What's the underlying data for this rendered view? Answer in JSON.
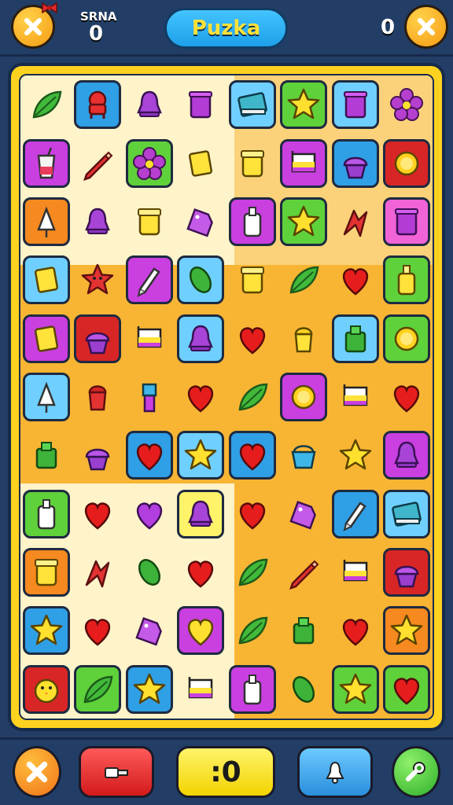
{
  "header": {
    "left_button_icon": "close-icon",
    "score_label": "SRNA",
    "score_value": "0",
    "title": "Puzka",
    "right_score": "0",
    "right_button_icon": "close-icon"
  },
  "footer": {
    "buttons": [
      {
        "icon": "close-icon"
      },
      {
        "icon": "hammer-icon"
      },
      {
        "label": ":0"
      },
      {
        "icon": "bell-icon"
      },
      {
        "icon": "wrench-icon"
      }
    ]
  },
  "colors": {
    "zone_light": "#fff3c9",
    "zone_orange": "#f8b534",
    "frame": "#ffd21f"
  },
  "board": {
    "rows": 11,
    "cols": 7,
    "pieces": [
      [
        {
          "i": "leaf",
          "t": ""
        },
        {
          "i": "robot",
          "t": "blue"
        },
        {
          "i": "bell",
          "t": ""
        },
        {
          "i": "cup",
          "t": ""
        },
        {
          "i": "book",
          "t": "cyan"
        },
        {
          "i": "star",
          "t": "green"
        },
        {
          "i": "cup",
          "t": "cyan"
        },
        {
          "i": "flower",
          "t": ""
        }
      ],
      [
        {
          "i": "drink",
          "t": "magenta"
        },
        {
          "i": "pencil",
          "t": ""
        },
        {
          "i": "flower",
          "t": "green"
        },
        {
          "i": "gem",
          "t": ""
        },
        {
          "i": "jar",
          "t": ""
        },
        {
          "i": "flag",
          "t": "magenta"
        },
        {
          "i": "muffin",
          "t": "blue"
        },
        {
          "i": "sun",
          "t": "red"
        }
      ],
      [
        {
          "i": "shell",
          "t": "orange"
        },
        {
          "i": "bell",
          "t": ""
        },
        {
          "i": "jar",
          "t": ""
        },
        {
          "i": "tag",
          "t": ""
        },
        {
          "i": "bottle",
          "t": "magenta"
        },
        {
          "i": "star",
          "t": "green"
        },
        {
          "i": "knot",
          "t": ""
        },
        {
          "i": "cup",
          "t": "pink"
        }
      ],
      [
        {
          "i": "gem",
          "t": "cyan"
        },
        {
          "i": "starface",
          "t": ""
        },
        {
          "i": "pen",
          "t": "magenta"
        },
        {
          "i": "oval",
          "t": "cyan"
        },
        {
          "i": "jar",
          "t": ""
        },
        {
          "i": "leaf",
          "t": ""
        },
        {
          "i": "heart",
          "t": ""
        },
        {
          "i": "bottle2",
          "t": "green"
        }
      ],
      [
        {
          "i": "gem",
          "t": "magenta"
        },
        {
          "i": "muffin",
          "t": "red"
        },
        {
          "i": "flag",
          "t": ""
        },
        {
          "i": "bell",
          "t": "cyan"
        },
        {
          "i": "heart",
          "t": ""
        },
        {
          "i": "lamp",
          "t": ""
        },
        {
          "i": "can",
          "t": "cyan"
        },
        {
          "i": "sun",
          "t": "green"
        }
      ],
      [
        {
          "i": "shell",
          "t": "cyan"
        },
        {
          "i": "lamp2",
          "t": ""
        },
        {
          "i": "brush",
          "t": ""
        },
        {
          "i": "heart",
          "t": ""
        },
        {
          "i": "leaf",
          "t": ""
        },
        {
          "i": "sun",
          "t": "magenta"
        },
        {
          "i": "flag",
          "t": ""
        },
        {
          "i": "heart",
          "t": ""
        }
      ],
      [
        {
          "i": "can",
          "t": ""
        },
        {
          "i": "muffin",
          "t": ""
        },
        {
          "i": "heart",
          "t": "blue"
        },
        {
          "i": "star",
          "t": "cyan"
        },
        {
          "i": "heart",
          "t": "blue"
        },
        {
          "i": "basket",
          "t": ""
        },
        {
          "i": "star",
          "t": ""
        },
        {
          "i": "bell",
          "t": "magenta"
        }
      ],
      [
        {
          "i": "bottle",
          "t": "green"
        },
        {
          "i": "heart",
          "t": ""
        },
        {
          "i": "heartp",
          "t": ""
        },
        {
          "i": "bell",
          "t": "yellow"
        },
        {
          "i": "heart",
          "t": ""
        },
        {
          "i": "tag",
          "t": ""
        },
        {
          "i": "pen",
          "t": "blue"
        },
        {
          "i": "book",
          "t": "cyan"
        }
      ],
      [
        {
          "i": "jar",
          "t": "orange"
        },
        {
          "i": "knot",
          "t": ""
        },
        {
          "i": "oval",
          "t": ""
        },
        {
          "i": "heart",
          "t": ""
        },
        {
          "i": "leaf",
          "t": ""
        },
        {
          "i": "pencil",
          "t": ""
        },
        {
          "i": "flag",
          "t": ""
        },
        {
          "i": "muffin",
          "t": "red"
        }
      ],
      [
        {
          "i": "star",
          "t": "blue"
        },
        {
          "i": "heart",
          "t": ""
        },
        {
          "i": "tag",
          "t": ""
        },
        {
          "i": "hearty",
          "t": "magenta"
        },
        {
          "i": "leaf",
          "t": ""
        },
        {
          "i": "can",
          "t": ""
        },
        {
          "i": "heart",
          "t": ""
        },
        {
          "i": "star",
          "t": "orange"
        }
      ],
      [
        {
          "i": "chick",
          "t": "red"
        },
        {
          "i": "leaf",
          "t": "green"
        },
        {
          "i": "star",
          "t": "blue"
        },
        {
          "i": "flag",
          "t": ""
        },
        {
          "i": "bottle",
          "t": "magenta"
        },
        {
          "i": "oval",
          "t": ""
        },
        {
          "i": "star",
          "t": "green"
        },
        {
          "i": "heart",
          "t": "green"
        }
      ]
    ]
  }
}
